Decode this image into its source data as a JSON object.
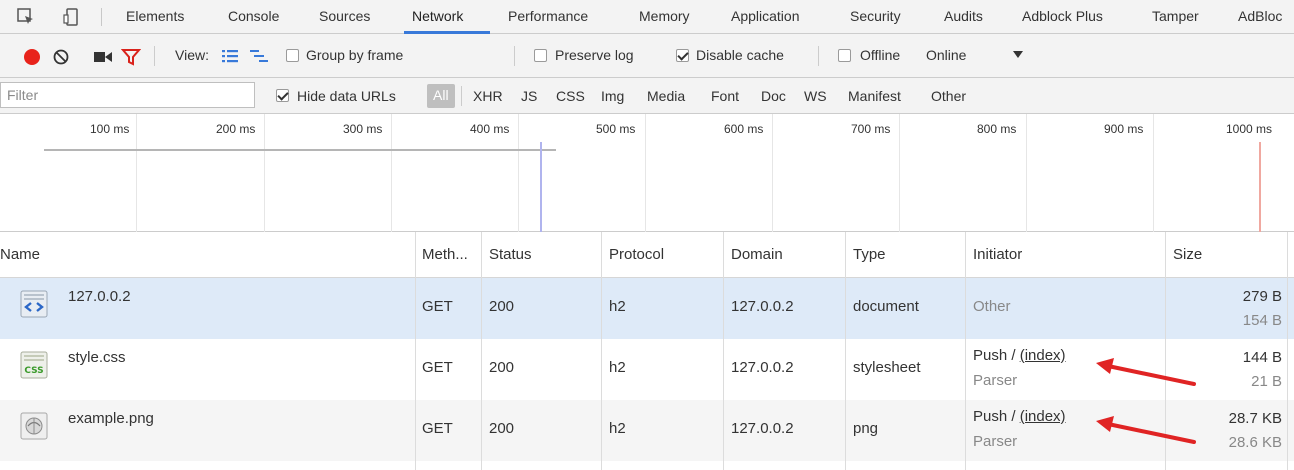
{
  "tabs": [
    "Elements",
    "Console",
    "Sources",
    "Network",
    "Performance",
    "Memory",
    "Application",
    "Security",
    "Audits",
    "Adblock Plus",
    "Tamper",
    "AdBloc"
  ],
  "active_tab": "Network",
  "toolbar": {
    "view_label": "View:",
    "group_by_frame": "Group by frame",
    "preserve_log": "Preserve log",
    "disable_cache": "Disable cache",
    "offline": "Offline",
    "throttle_value": "Online"
  },
  "filter": {
    "placeholder": "Filter",
    "hide_data_urls": "Hide data URLs",
    "types": [
      "All",
      "XHR",
      "JS",
      "CSS",
      "Img",
      "Media",
      "Font",
      "Doc",
      "WS",
      "Manifest",
      "Other"
    ]
  },
  "timeline": {
    "ticks": [
      "100 ms",
      "200 ms",
      "300 ms",
      "400 ms",
      "500 ms",
      "600 ms",
      "700 ms",
      "800 ms",
      "900 ms",
      "1000 ms"
    ]
  },
  "columns": [
    "Name",
    "Meth...",
    "Status",
    "Protocol",
    "Domain",
    "Type",
    "Initiator",
    "Size"
  ],
  "rows": [
    {
      "name": "127.0.0.2",
      "method": "GET",
      "status": "200",
      "protocol": "h2",
      "domain": "127.0.0.2",
      "type": "document",
      "initiator": "Other",
      "initiator_sub": "",
      "size": "279 B",
      "size_sub": "154 B",
      "icon": "html-document-icon"
    },
    {
      "name": "style.css",
      "method": "GET",
      "status": "200",
      "protocol": "h2",
      "domain": "127.0.0.2",
      "type": "stylesheet",
      "initiator_prefix": "Push / ",
      "initiator_link": "(index)",
      "initiator_sub": "Parser",
      "size": "144 B",
      "size_sub": "21 B",
      "icon": "css-file-icon"
    },
    {
      "name": "example.png",
      "method": "GET",
      "status": "200",
      "protocol": "h2",
      "domain": "127.0.0.2",
      "type": "png",
      "initiator_prefix": "Push / ",
      "initiator_link": "(index)",
      "initiator_sub": "Parser",
      "size": "28.7 KB",
      "size_sub": "28.6 KB",
      "icon": "image-file-icon"
    }
  ],
  "colors": {
    "accent": "#3879d9",
    "record": "#e8231b",
    "selected_row": "#deeaf8",
    "arrow": "#e02424"
  }
}
